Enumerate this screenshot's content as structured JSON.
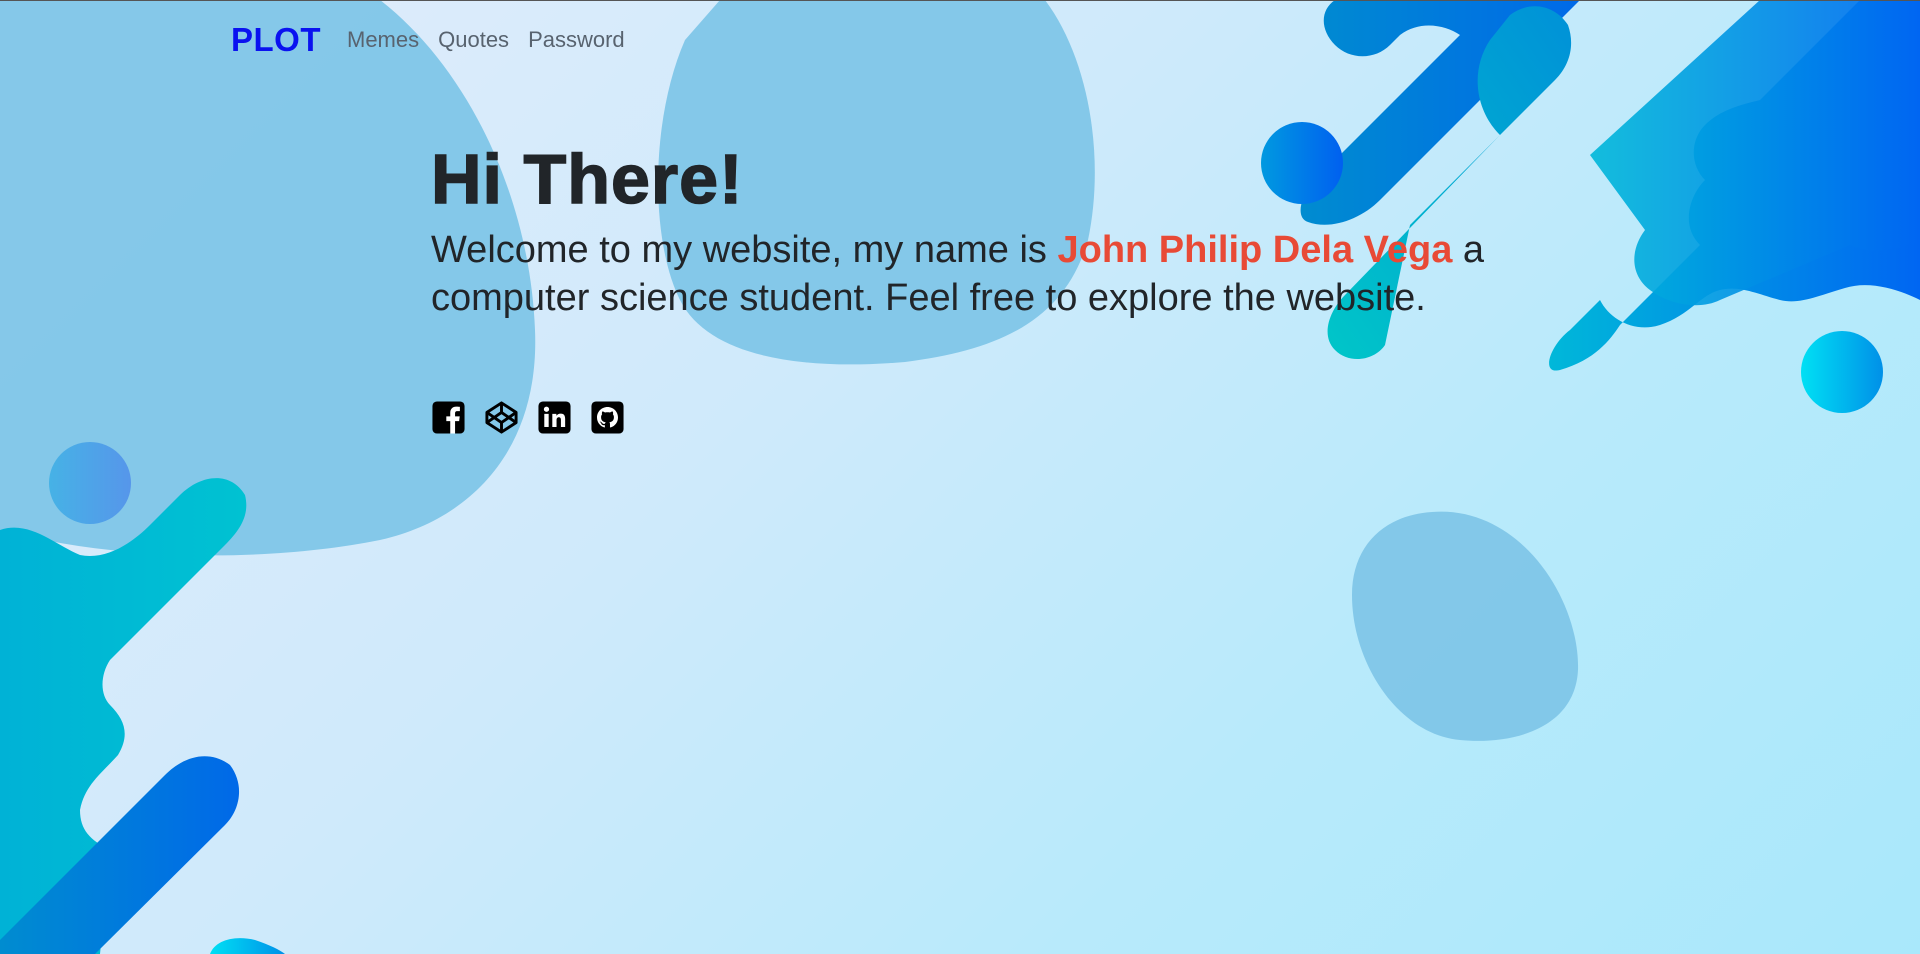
{
  "navbar": {
    "brand": "PLOT",
    "links": [
      {
        "label": "Memes"
      },
      {
        "label": "Quotes"
      },
      {
        "label": "Password"
      }
    ]
  },
  "hero": {
    "heading": "Hi There!",
    "intro_before": "Welcome to my website, my name is ",
    "name": "John Philip Dela Vega",
    "intro_after": " a computer science student. Feel free to explore the website."
  },
  "social_links": [
    {
      "icon": "facebook-icon"
    },
    {
      "icon": "codepen-icon"
    },
    {
      "icon": "linkedin-icon"
    },
    {
      "icon": "github-icon"
    }
  ],
  "colors": {
    "brand": "#0a12f0",
    "name_highlight": "#e84a36",
    "text": "#212529",
    "nav_link": "#58636f"
  }
}
